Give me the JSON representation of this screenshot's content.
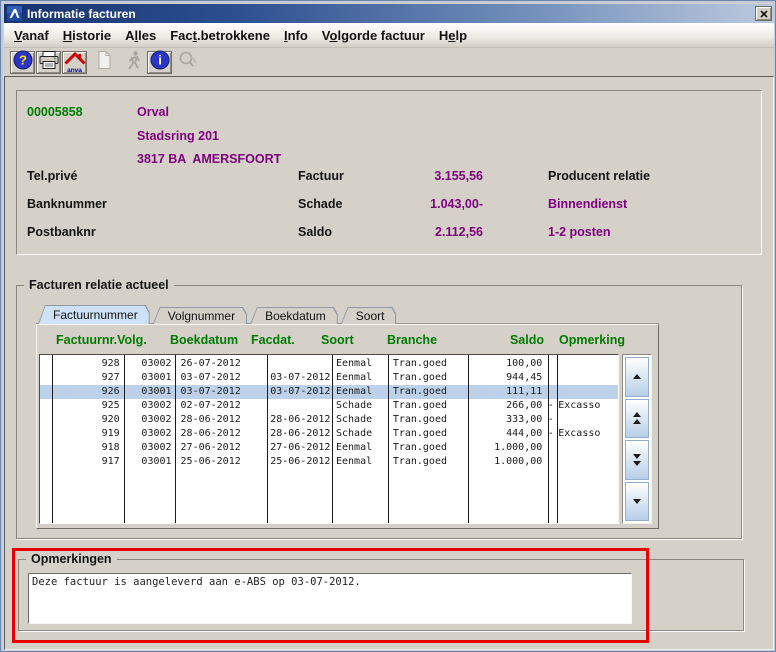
{
  "window": {
    "title": "Informatie facturen"
  },
  "menu": {
    "items": [
      {
        "label": "Vanaf",
        "accel": 0
      },
      {
        "label": "Historie",
        "accel": 0
      },
      {
        "label": "Alles",
        "accel": 1
      },
      {
        "label": "Fact.betrokkene",
        "accel": 3
      },
      {
        "label": "Info",
        "accel": 0
      },
      {
        "label": "Volgorde factuur",
        "accel": 1
      },
      {
        "label": "Help",
        "accel": 1
      }
    ]
  },
  "toolbar": {
    "buttons": [
      {
        "icon": "help-icon",
        "enabled": true
      },
      {
        "icon": "print-icon",
        "enabled": true
      },
      {
        "icon": "anva-home-icon",
        "enabled": true,
        "label": "anva"
      },
      {
        "icon": "new-document-icon",
        "enabled": false
      },
      {
        "icon": "run-icon",
        "enabled": false
      },
      {
        "icon": "info-icon",
        "enabled": true
      },
      {
        "icon": "search-icon",
        "enabled": false
      }
    ]
  },
  "relation": {
    "number": "00005858",
    "name": "Orval",
    "street": "Stadsring 201",
    "city": "3817 BA  AMERSFOORT",
    "left_labels": [
      "Tel.privé",
      "Banknummer",
      "Postbanknr"
    ],
    "amounts": [
      {
        "label": "Factuur",
        "value": "3.155,56"
      },
      {
        "label": "Schade",
        "value": "1.043,00-"
      },
      {
        "label": "Saldo",
        "value": "2.112,56"
      }
    ],
    "right_info": [
      {
        "text": "Producent relatie",
        "color": "black"
      },
      {
        "text": "Binnendienst",
        "color": "purple"
      },
      {
        "text": "1-2 posten",
        "color": "purple"
      }
    ]
  },
  "invoices": {
    "group_title": "Facturen relatie actueel",
    "tabs": [
      {
        "label": "Factuurnummer",
        "active": true
      },
      {
        "label": "Volgnummer",
        "active": false
      },
      {
        "label": "Boekdatum",
        "active": false
      },
      {
        "label": "Soort",
        "active": false
      }
    ],
    "columns": [
      "Factuurnr.Volg.",
      "Boekdatum",
      "Facdat.",
      "Soort",
      "Branche",
      "Saldo",
      "Opmerking"
    ],
    "rows": [
      {
        "nr": "928",
        "volg": "03002",
        "boekdatum": "26-07-2012",
        "facdat": "",
        "soort": "Eenmal",
        "branche": "Tran.goed",
        "saldo": "100,00",
        "dash": "",
        "opmerking": "",
        "selected": false
      },
      {
        "nr": "927",
        "volg": "03001",
        "boekdatum": "03-07-2012",
        "facdat": "03-07-2012",
        "soort": "Eenmal",
        "branche": "Tran.goed",
        "saldo": "944,45",
        "dash": "",
        "opmerking": "",
        "selected": false
      },
      {
        "nr": "926",
        "volg": "03001",
        "boekdatum": "03-07-2012",
        "facdat": "03-07-2012",
        "soort": "Eenmal",
        "branche": "Tran.goed",
        "saldo": "111,11",
        "dash": "",
        "opmerking": "",
        "selected": true
      },
      {
        "nr": "925",
        "volg": "03002",
        "boekdatum": "02-07-2012",
        "facdat": "",
        "soort": "Schade",
        "branche": "Tran.goed",
        "saldo": "266,00",
        "dash": "-",
        "opmerking": "Excasso",
        "selected": false
      },
      {
        "nr": "920",
        "volg": "03002",
        "boekdatum": "28-06-2012",
        "facdat": "28-06-2012",
        "soort": "Schade",
        "branche": "Tran.goed",
        "saldo": "333,00",
        "dash": "-",
        "opmerking": "",
        "selected": false
      },
      {
        "nr": "919",
        "volg": "03002",
        "boekdatum": "28-06-2012",
        "facdat": "28-06-2012",
        "soort": "Schade",
        "branche": "Tran.goed",
        "saldo": "444,00",
        "dash": "-",
        "opmerking": "Excasso",
        "selected": false
      },
      {
        "nr": "918",
        "volg": "03002",
        "boekdatum": "27-06-2012",
        "facdat": "27-06-2012",
        "soort": "Eenmal",
        "branche": "Tran.goed",
        "saldo": "1.000,00",
        "dash": "",
        "opmerking": "",
        "selected": false
      },
      {
        "nr": "917",
        "volg": "03001",
        "boekdatum": "25-06-2012",
        "facdat": "25-06-2012",
        "soort": "Eenmal",
        "branche": "Tran.goed",
        "saldo": "1.000,00",
        "dash": "",
        "opmerking": "",
        "selected": false
      }
    ],
    "scroll_buttons": [
      "up",
      "up-double",
      "down-double",
      "down"
    ]
  },
  "remarks": {
    "group_title": "Opmerkingen",
    "text": "Deze factuur is aangeleverd aan e-ABS op 03-07-2012."
  },
  "colors": {
    "accent_purple": "#800080",
    "accent_green": "#007a00",
    "header_green": "#007a00",
    "selected_row": "#bdd2ea",
    "tab_active": "#cde2f6",
    "annotation_red": "#e60000"
  }
}
